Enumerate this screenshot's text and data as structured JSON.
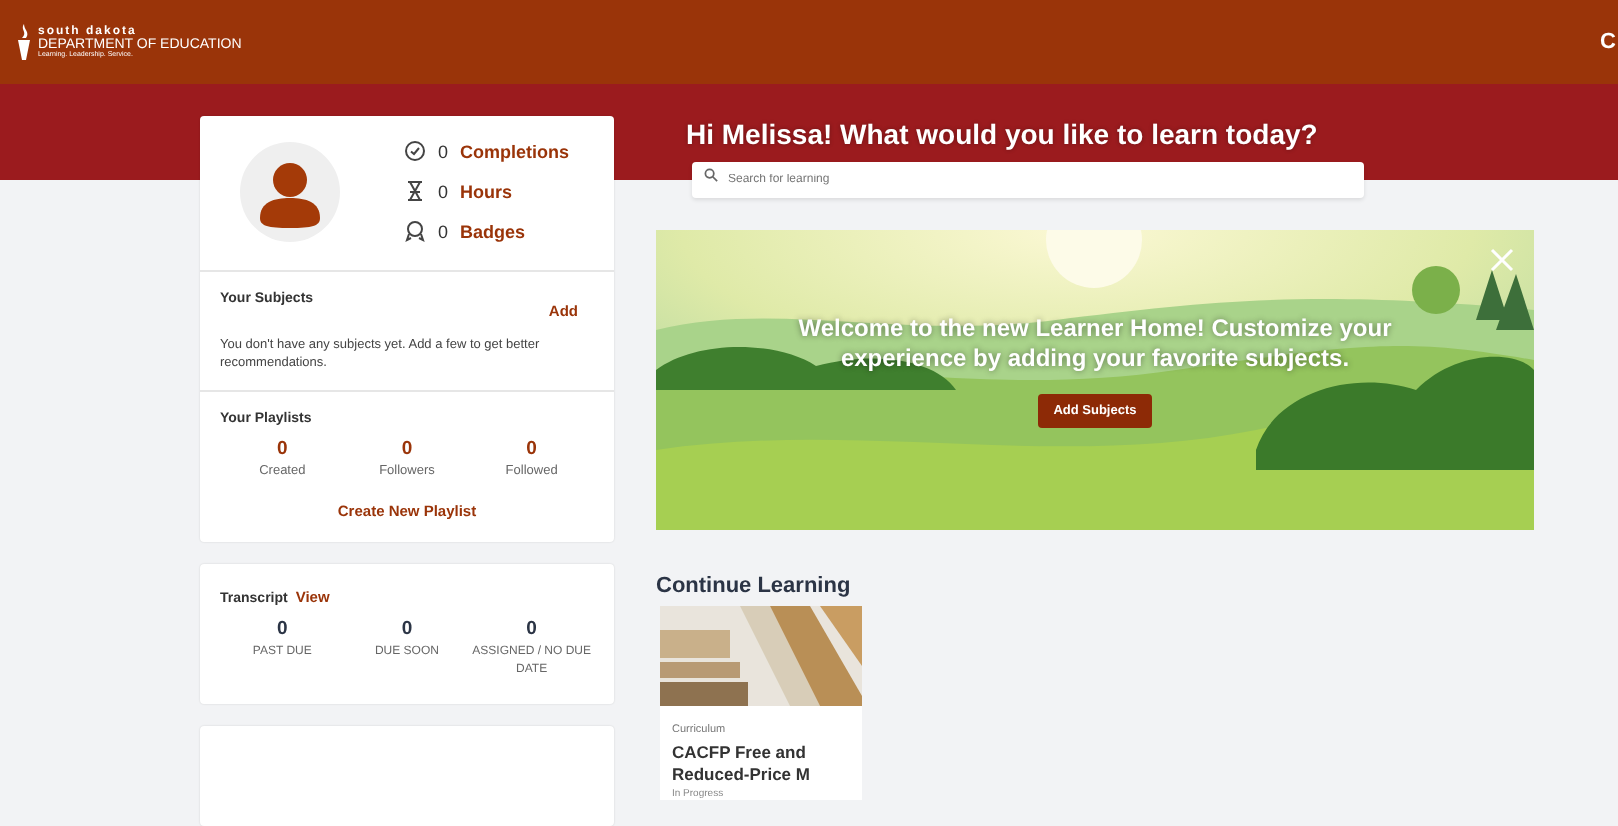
{
  "header": {
    "logo": {
      "line1": "south dakota",
      "line2": "DEPARTMENT OF EDUCATION",
      "tagline": "Learning. Leadership. Service."
    },
    "user_initial": "C"
  },
  "profile": {
    "stats": [
      {
        "kind": "completions",
        "value": "0",
        "label": "Completions"
      },
      {
        "kind": "hours",
        "value": "0",
        "label": "Hours"
      },
      {
        "kind": "badges",
        "value": "0",
        "label": "Badges"
      }
    ]
  },
  "subjects": {
    "title": "Your Subjects",
    "action": "Add",
    "message": "You don't have any subjects yet. Add a few to get better recommendations."
  },
  "playlists": {
    "title": "Your Playlists",
    "stats": [
      {
        "value": "0",
        "label": "Created"
      },
      {
        "value": "0",
        "label": "Followers"
      },
      {
        "value": "0",
        "label": "Followed"
      }
    ],
    "action": "Create New Playlist"
  },
  "transcript": {
    "title": "Transcript",
    "action": "View",
    "stats": [
      {
        "value": "0",
        "label": "PAST DUE"
      },
      {
        "value": "0",
        "label": "DUE SOON"
      },
      {
        "value": "0",
        "label": "ASSIGNED / NO DUE DATE"
      }
    ]
  },
  "greeting": "Hi Melissa! What would you like to learn today?",
  "search": {
    "placeholder": "Search for learning"
  },
  "hero": {
    "message": "Welcome to the new Learner Home! Customize your experience by adding your favorite subjects.",
    "button": "Add Subjects"
  },
  "continue_learning": {
    "title": "Continue Learning",
    "courses": [
      {
        "type": "Curriculum",
        "title": "CACFP Free and Reduced-Price M",
        "status": "In Progress"
      }
    ]
  }
}
